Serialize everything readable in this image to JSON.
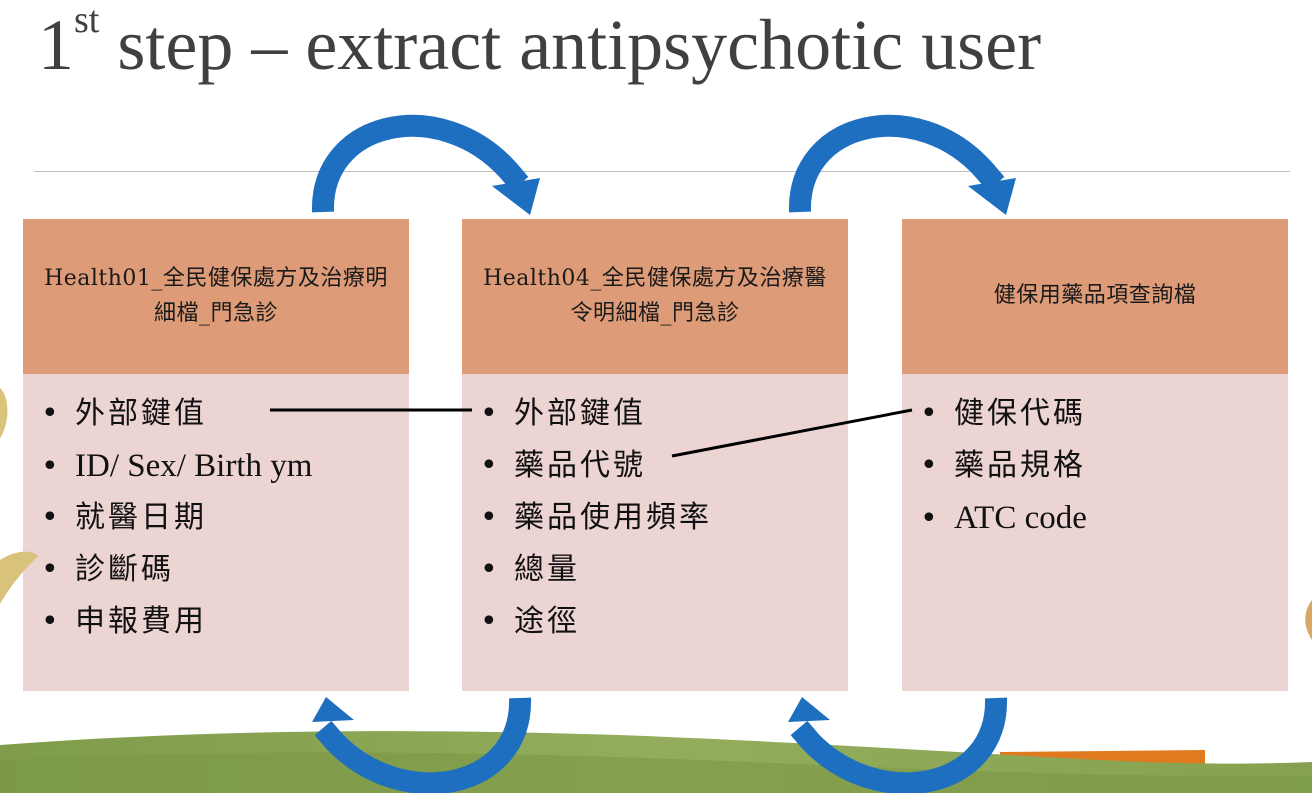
{
  "title": {
    "main": "step – extract antipsychotic user",
    "prefix": "1",
    "superscript": "st"
  },
  "boxes": {
    "health01": {
      "header": "Health01_全民健保處方及治療明細檔_門急診",
      "items": [
        "外部鍵值",
        "ID/ Sex/ Birth ym",
        "就醫日期",
        "診斷碼",
        "申報費用"
      ]
    },
    "health04": {
      "header": "Health04_全民健保處方及治療醫令明細檔_門急診",
      "items": [
        "外部鍵值",
        "藥品代號",
        "藥品使用頻率",
        "總量",
        "途徑"
      ]
    },
    "nhi": {
      "header": "健保用藥品項查詢檔",
      "items": [
        "健保代碼",
        "藥品規格",
        "ATC code"
      ]
    }
  },
  "bullet": "•",
  "colors": {
    "header_fill": "#dd9b78",
    "body_fill": "#ecd4d2",
    "arrow_blue": "#1f6fc0",
    "title_gray": "#404040",
    "ground_green": "#8aa552",
    "accent_orange": "#e07a1f"
  },
  "icons": [
    "curved-arrow-icon"
  ]
}
